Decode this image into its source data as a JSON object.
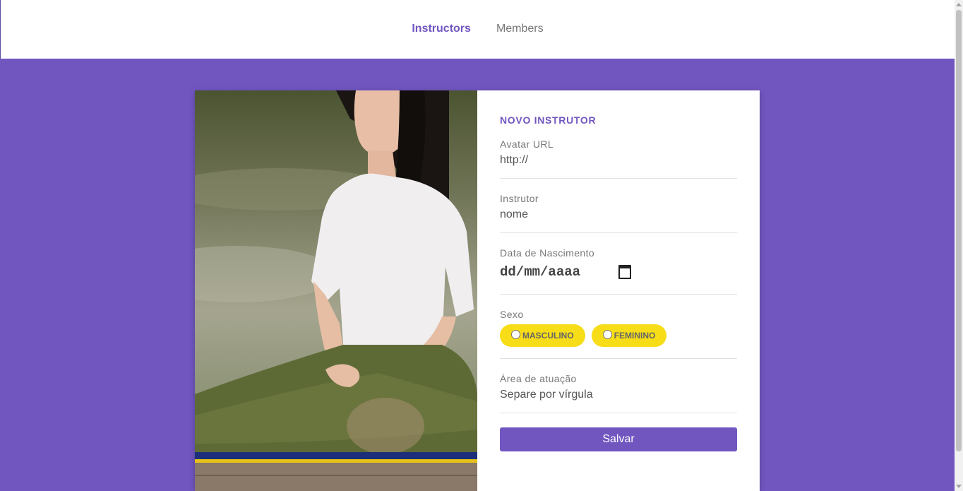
{
  "nav": {
    "items": [
      {
        "label": "Instructors",
        "active": true
      },
      {
        "label": "Members",
        "active": false
      }
    ]
  },
  "form": {
    "title": "NOVO INSTRUTOR",
    "avatar": {
      "label": "Avatar URL",
      "placeholder": "http://"
    },
    "name": {
      "label": "Instrutor",
      "placeholder": "nome"
    },
    "birth": {
      "label": "Data de Nascimento",
      "value": "dd/mm/aaaa",
      "icon": "calendar-icon"
    },
    "gender": {
      "label": "Sexo",
      "options": [
        "MASCULINO",
        "FEMININO"
      ]
    },
    "services": {
      "label": "Área de atuação",
      "placeholder": "Separe por vírgula"
    },
    "submit_label": "Salvar"
  },
  "colors": {
    "accent": "#7156c0",
    "pill": "#f6dd17",
    "background": "#7156c0"
  }
}
